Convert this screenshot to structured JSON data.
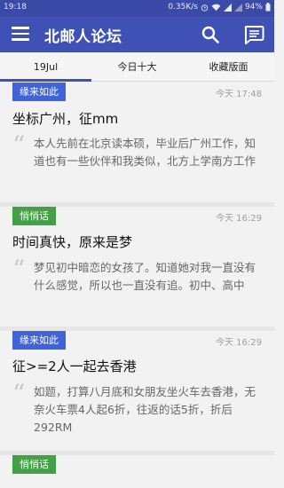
{
  "status_bar": {
    "time": "19:18",
    "speed": "0.35K/s",
    "battery": "94%"
  },
  "app_bar": {
    "title": "北邮人论坛"
  },
  "tabs": [
    {
      "label": "19Jul",
      "selected": true
    },
    {
      "label": "今日十大",
      "selected": false
    },
    {
      "label": "收藏版面",
      "selected": false
    }
  ],
  "posts": [
    {
      "board": "缘来如此",
      "board_color": "#3f63d8",
      "time": "今天 17:48",
      "title": "坐标广州，征mm",
      "excerpt": "本人先前在北京读本硕，毕业后广州工作，知道也有一些伙伴和我类似，北方上学南方工作"
    },
    {
      "board": "悄悄话",
      "board_color": "#43a047",
      "time": "今天 16:29",
      "title": "时间真快，原来是梦",
      "excerpt": "梦见初中暗恋的女孩了。知道她对我一直没有什么感觉，所以也一直没有追。初中、高中"
    },
    {
      "board": "缘来如此",
      "board_color": "#3f63d8",
      "time": "今天 16:29",
      "title": "征>=2人一起去香港",
      "excerpt": "如题，打算八月底和女朋友坐火车去香港，无奈火车票4人起6折，往返的话5折，折后292RM"
    },
    {
      "board": "悄悄话",
      "board_color": "#43a047",
      "time": "",
      "title": "",
      "excerpt": ""
    }
  ],
  "colors": {
    "primary": "#3f51b5",
    "status_bar": "#3b4aa7"
  }
}
